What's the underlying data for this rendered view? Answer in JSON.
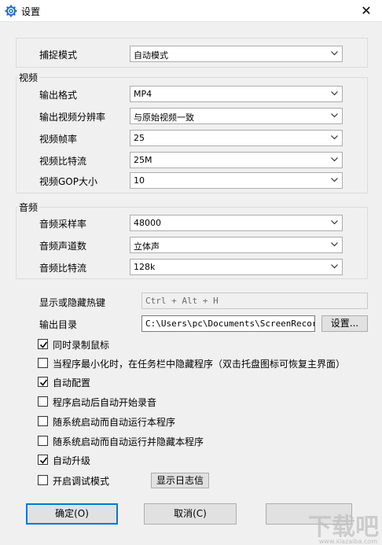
{
  "window": {
    "title": "设置",
    "close_glyph": "✕"
  },
  "capture": {
    "label": "捕捉模式",
    "value": "自动模式"
  },
  "video": {
    "group_title": "视频",
    "rows": [
      {
        "label": "输出格式",
        "value": "MP4"
      },
      {
        "label": "输出视频分辨率",
        "value": "与原始视频一致"
      },
      {
        "label": "视频帧率",
        "value": "25"
      },
      {
        "label": "视频比特流",
        "value": "25M"
      },
      {
        "label": "视频GOP大小",
        "value": "10"
      }
    ]
  },
  "audio": {
    "group_title": "音频",
    "rows": [
      {
        "label": "音频采样率",
        "value": "48000"
      },
      {
        "label": "音频声道数",
        "value": "立体声"
      },
      {
        "label": "音频比特流",
        "value": "128k"
      }
    ]
  },
  "hotkey": {
    "label": "显示或隐藏热键",
    "value": "Ctrl + Alt + H"
  },
  "output": {
    "label": "输出目录",
    "value": "C:\\Users\\pc\\Documents\\ScreenRecorder",
    "browse_label": "设置..."
  },
  "options": [
    {
      "label": "同时录制鼠标",
      "checked": true
    },
    {
      "label": "当程序最小化时，在任务栏中隐藏程序（双击托盘图标可恢复主界面）",
      "checked": false
    },
    {
      "label": "自动配置",
      "checked": true
    },
    {
      "label": "程序启动后自动开始录音",
      "checked": false
    },
    {
      "label": "随系统启动而自动运行本程序",
      "checked": false
    },
    {
      "label": "随系统启动而自动运行并隐藏本程序",
      "checked": false
    },
    {
      "label": "自动升级",
      "checked": true
    },
    {
      "label": "开启调试模式",
      "checked": false
    }
  ],
  "log_button": "显示日志信",
  "footer": {
    "ok": "确定(O)",
    "cancel": "取消(C)"
  },
  "watermark": {
    "text": "下载吧",
    "sub": "www.xiazaiba.com"
  },
  "colors": {
    "accent": "#0078d7",
    "check": "#000000"
  }
}
